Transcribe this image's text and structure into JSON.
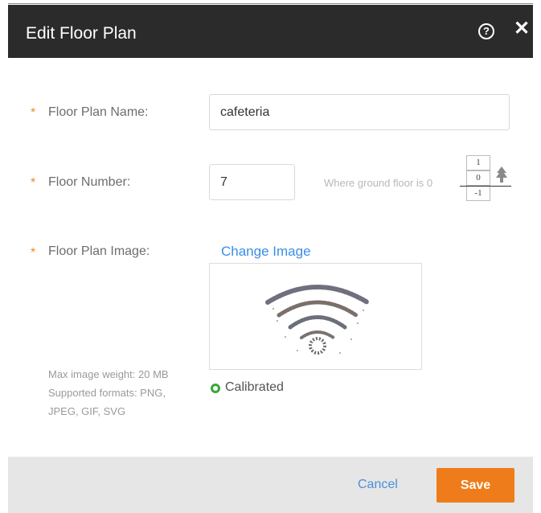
{
  "dialog": {
    "title": "Edit Floor Plan",
    "help_icon": "question-circle-icon",
    "close_icon": "close-x-icon"
  },
  "form": {
    "required_marker": "*",
    "name_label": "Floor Plan Name:",
    "name_value": "cafeteria",
    "number_label": "Floor Number:",
    "number_value": "7",
    "ground_hint": "Where ground floor is 0",
    "floor_stack": [
      "1",
      "0",
      "-1"
    ],
    "image_label": "Floor Plan Image:",
    "change_image": "Change Image",
    "max_weight": "Max image weight: 20 MB",
    "formats_line1": "Supported formats: PNG,",
    "formats_line2": "JPEG, GIF, SVG",
    "calibrated": "Calibrated"
  },
  "footer": {
    "cancel": "Cancel",
    "save": "Save"
  },
  "colors": {
    "header_bg": "#2b2b2b",
    "accent": "#ef7c1a",
    "link": "#3a8ee6",
    "required": "#f08a24",
    "calibrated": "#3aa835"
  }
}
